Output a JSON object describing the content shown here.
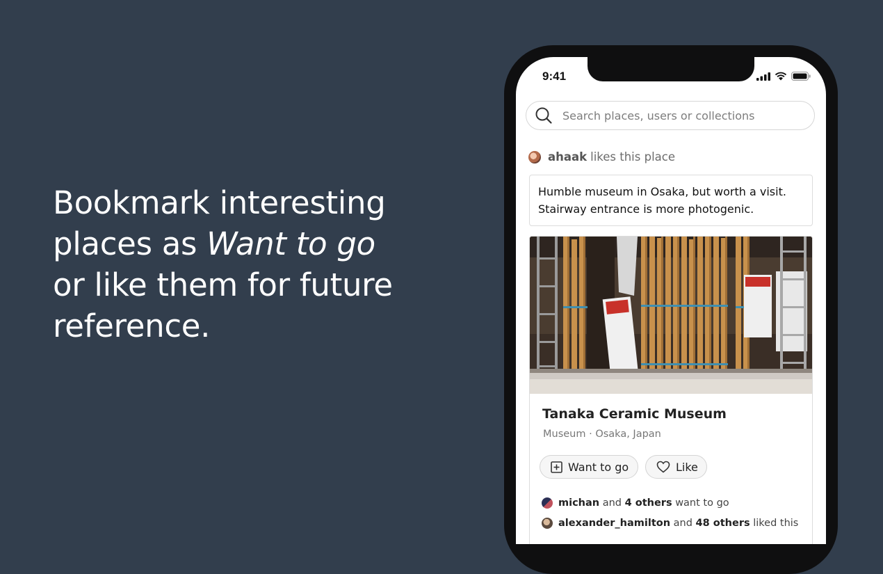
{
  "tagline": {
    "part1": "Bookmark interesting places as ",
    "emphasis": "Want to go",
    "part2": " or like them for future reference."
  },
  "status_bar": {
    "time": "9:41"
  },
  "search": {
    "placeholder": "Search places, users or collections"
  },
  "activity": {
    "user": "ahaak",
    "text": "likes this place"
  },
  "note": {
    "line1": "Humble museum in Osaka, but worth a visit.",
    "line2": "Stairway entrance is more photogenic."
  },
  "place": {
    "name": "Tanaka Ceramic Museum",
    "meta": "Museum · Osaka, Japan",
    "want_label": "Want to go",
    "like_label": "Like"
  },
  "social": {
    "want": {
      "user": "michan",
      "and": "and",
      "others": "4 others",
      "suffix": "want to go"
    },
    "liked": {
      "user": "alexander_hamilton",
      "and": "and",
      "others": "48 others",
      "suffix": "liked this"
    }
  }
}
